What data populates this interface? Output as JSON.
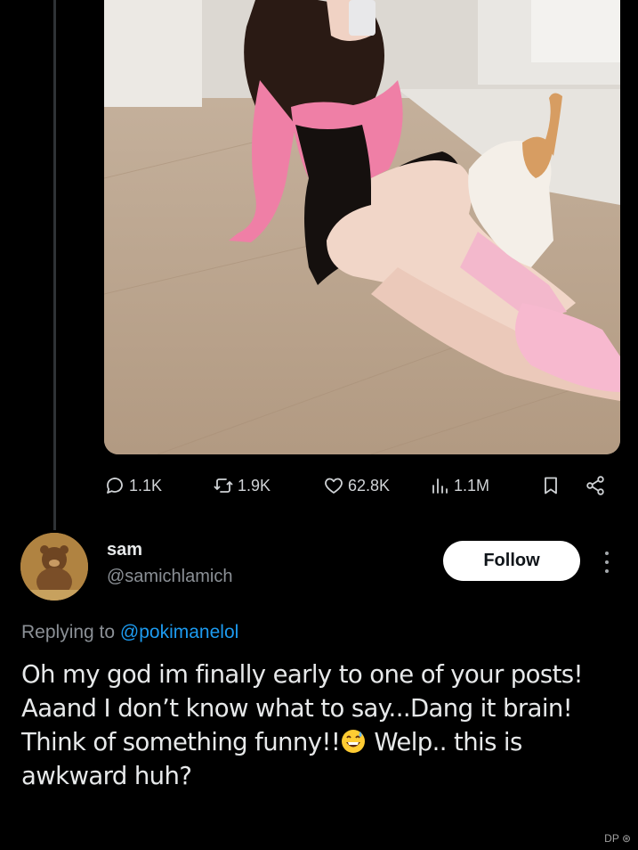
{
  "tweet": {
    "metrics": {
      "replies": "1.1K",
      "retweets": "1.9K",
      "likes": "62.8K",
      "views": "1.1M"
    }
  },
  "reply": {
    "display_name": "sam",
    "handle": "@samichlamich",
    "follow_label": "Follow",
    "replying_prefix": "Replying to",
    "replying_mention": "@pokimanelol",
    "text_part1": "Oh my god im finally early to one of your posts! Aaand I don’t know what to say...Dang it brain! Think of something funny!!",
    "emoji": "grinning-sweat-emoji",
    "text_part2": " Welp.. this is awkward huh?"
  },
  "watermark": "DP ⊛",
  "colors": {
    "background": "#000000",
    "text": "#e7e9ea",
    "secondary": "#8b9096",
    "link": "#1d9bf0",
    "follow_bg": "#ffffff"
  },
  "icons": [
    "reply-icon",
    "retweet-icon",
    "like-icon",
    "views-icon",
    "bookmark-icon",
    "share-icon",
    "more-icon"
  ]
}
